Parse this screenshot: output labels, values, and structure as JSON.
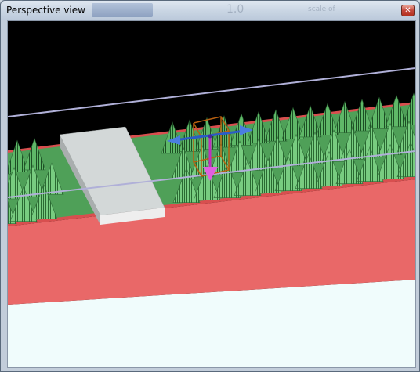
{
  "window": {
    "title": "Perspective view",
    "close_glyph": "✕",
    "background_ghost_text": [
      "1.0",
      "scale of"
    ]
  },
  "viewport": {
    "background_color": "#000000",
    "floor_color": "#f0fcfc",
    "platform_side_color": "#e96868",
    "platform_top_color": "#d84f4f",
    "tree_color": "#5fb868",
    "slab_color": "#d8dcdc",
    "guide_line_color": "#b0b0d8",
    "gizmo": {
      "x_axis_color": "#2a5cc6",
      "y_axis_color": "#c030c0",
      "bounding_box_color": "#b86010"
    }
  }
}
